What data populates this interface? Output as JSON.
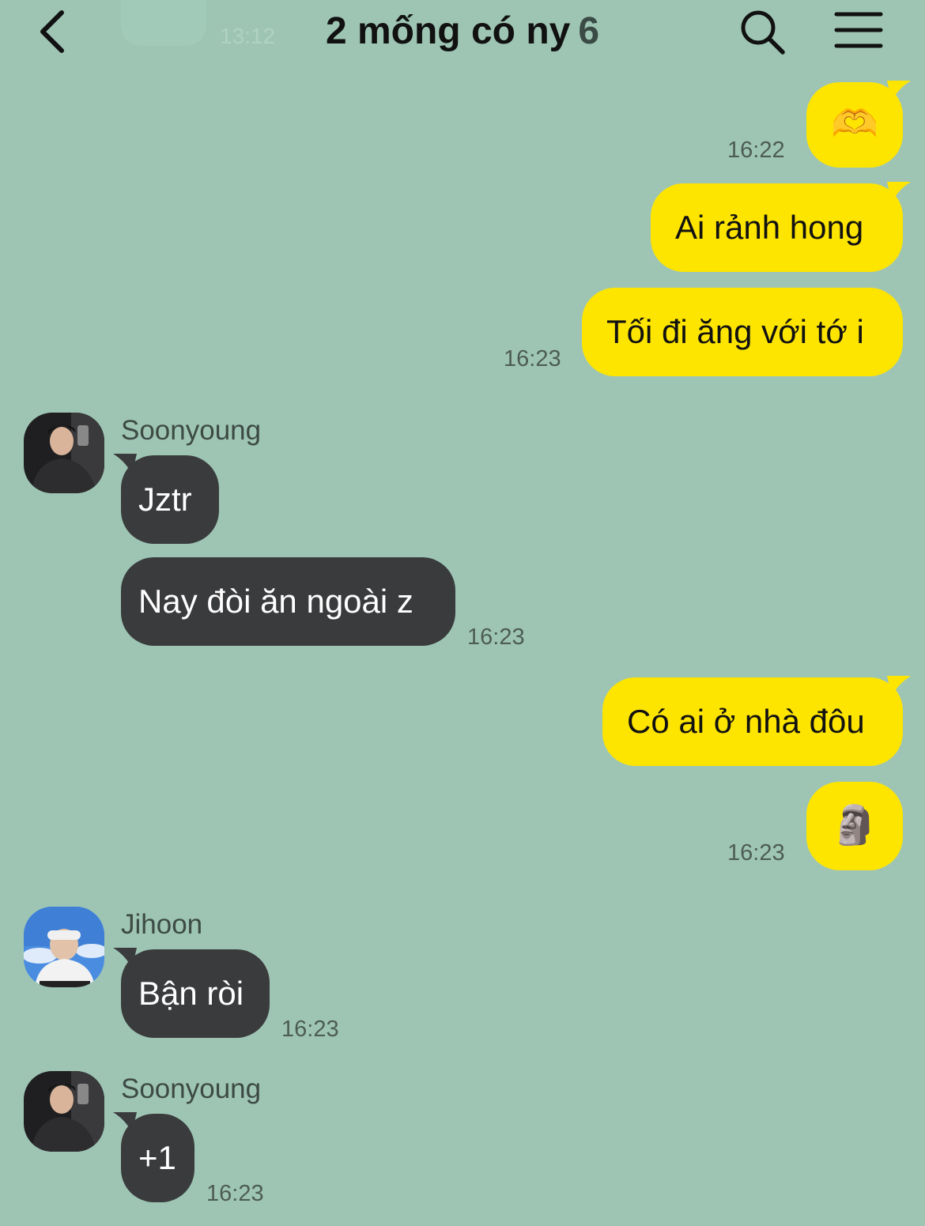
{
  "header": {
    "title": "2 mống có ny",
    "member_count": "6"
  },
  "top_peek": {
    "time": "13:12"
  },
  "messages": [
    {
      "content": "🫶",
      "time": "16:22"
    },
    {
      "content": "Ai rảnh hong"
    },
    {
      "content": "Tối đi ăng với tớ i",
      "time": "16:23"
    },
    {
      "sender": "Soonyoung",
      "content": "Jztr"
    },
    {
      "content": "Nay đòi ăn ngoài z",
      "time": "16:23"
    },
    {
      "content": "Có ai ở nhà đôu"
    },
    {
      "content": "🗿",
      "time": "16:23"
    },
    {
      "sender": "Jihoon",
      "content": "Bận ròi",
      "time": "16:23"
    },
    {
      "sender": "Soonyoung",
      "content": "+1",
      "time": "16:23"
    }
  ],
  "colors": {
    "background": "#9ec5b4",
    "my_bubble": "#fee500",
    "other_bubble": "#3a3b3d"
  },
  "icons": {
    "back": "chevron-left-icon",
    "search": "search-icon",
    "menu": "hamburger-menu-icon"
  }
}
